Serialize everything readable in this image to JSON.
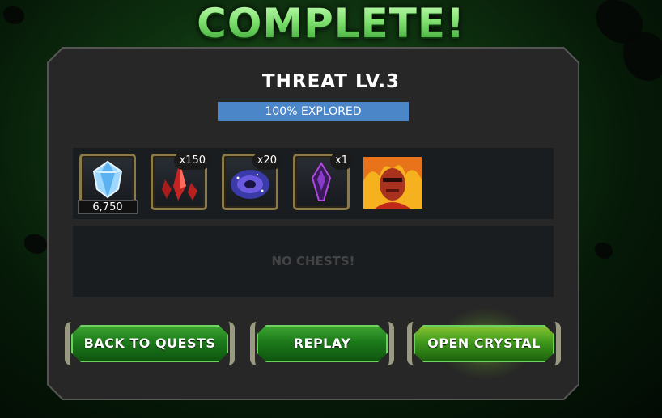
{
  "header": {
    "title": "COMPLETE!"
  },
  "quest": {
    "name": "THREAT LV.3"
  },
  "progress": {
    "label": "100% EXPLORED",
    "fraction": 1.0
  },
  "rewards": [
    {
      "icon": "blue-gem-icon",
      "amount": "6,750"
    },
    {
      "icon": "red-crystal-shards-icon",
      "count": "x150"
    },
    {
      "icon": "purple-orb-icon",
      "count": "x20"
    },
    {
      "icon": "purple-crystal-icon",
      "count": "x1"
    },
    {
      "icon": "hero-portrait-icon"
    }
  ],
  "chests": {
    "empty_text": "NO CHESTS!"
  },
  "buttons": {
    "back": "BACK TO QUESTS",
    "replay": "REPLAY",
    "open_crystal": "OPEN CRYSTAL"
  },
  "colors": {
    "progress_fill": "#4a86c8",
    "button_green": "#1d7a1a",
    "title_green": "#8de884"
  }
}
